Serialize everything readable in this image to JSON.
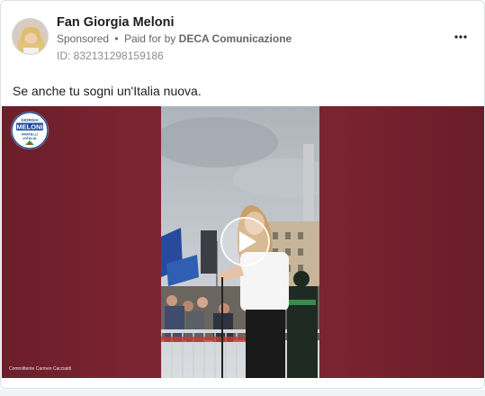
{
  "post": {
    "page_name": "Fan Giorgia Meloni",
    "sponsored_label": "Sponsored",
    "separator": "•",
    "paid_for_prefix": "Paid for by",
    "payer": "DECA Comunicazione",
    "ad_id": "ID: 832131298159186",
    "caption": "Se anche tu sogni un'Italia nuova.",
    "more_icon": "more-horizontal-icon"
  },
  "media": {
    "logo": {
      "top_text": "GIORGIA",
      "name_text": "MELONI",
      "sub_text_1": "FRATELLI",
      "sub_text_2": "d'ITALIA"
    },
    "play_icon": "play-icon",
    "credit": "Committente Carmen Caccialdi",
    "colors": {
      "background": "#7a2331",
      "logo_blue": "#1d4b9a",
      "flag_green": "#2f9e44",
      "flag_red": "#d62828"
    }
  }
}
